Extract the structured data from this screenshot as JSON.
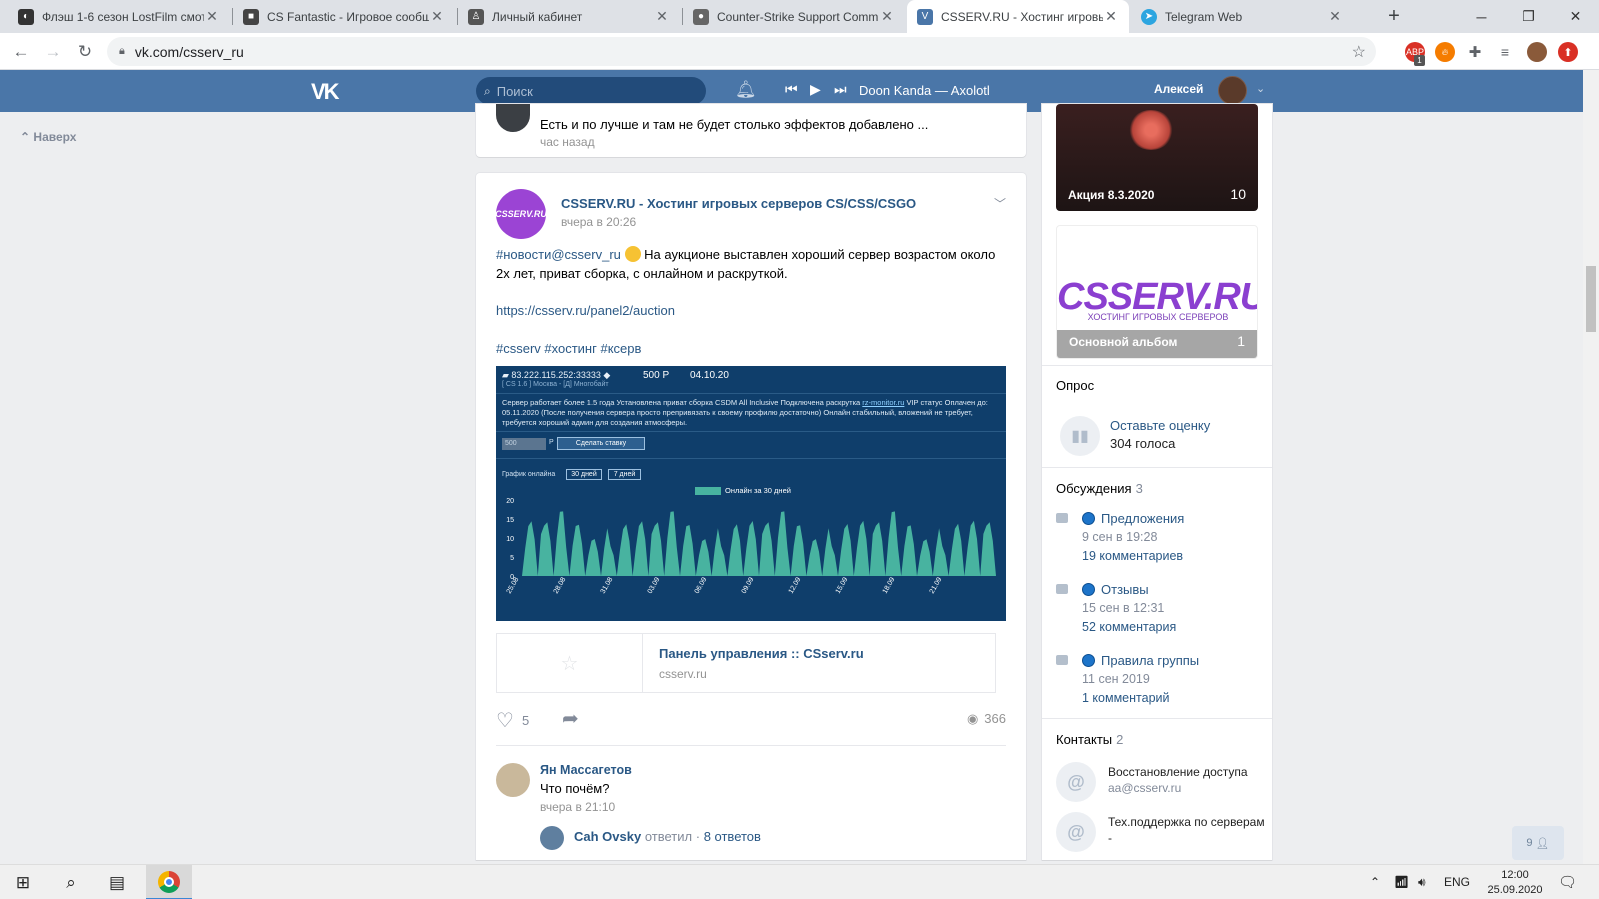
{
  "browser": {
    "tabs": [
      {
        "title": "Флэш 1-6 сезон LostFilm смот",
        "icon": "lostfilm-icon",
        "color": "#333333"
      },
      {
        "title": "CS Fantastic - Игровое сообщ",
        "icon": "csfantastic-icon",
        "color": "#444444"
      },
      {
        "title": "Личный кабинет",
        "icon": "cabinet-icon",
        "color": "#555555"
      },
      {
        "title": "Counter-Strike Support Comm",
        "icon": "cs-icon",
        "color": "#666666"
      },
      {
        "title": "CSSERV.RU - Хостинг игровых",
        "icon": "vk-icon",
        "color": "#4a76a8"
      },
      {
        "title": "Telegram Web",
        "icon": "telegram-icon",
        "color": "#2ca5e0"
      }
    ],
    "new_tab": "+",
    "url": "vk.com/csserv_ru",
    "ext_badge": "1"
  },
  "vk_header": {
    "logo": "VK",
    "search_placeholder": "Поиск",
    "now_playing": "Doon Kanda — Axolotl",
    "user_name": "Алексей"
  },
  "left": {
    "up_label": "Наверх"
  },
  "prev_post": {
    "comment_text": "Есть и по лучше и там не будет столько эффектов добавлено ...",
    "time": "час назад"
  },
  "post": {
    "author_avatar_text": "CSSERV.RU",
    "author": "CSSERV.RU - Хостинг игровых серверов CS/CSS/CSGO",
    "time": "вчера в 20:26",
    "hashtag": "#новости@csserv_ru",
    "text": "На аукционе выставлен хороший сервер возрастом около 2х лет, приват сборка, с онлайном и раскруткой.",
    "link": "https://csserv.ru/panel2/auction",
    "tags": "#csserv #хостинг #ксерв",
    "screenshot": {
      "ip": "83.222.115.252:33333",
      "meta": "[ CS 1.6 ] Москва - [Д] Многобайт",
      "price": "500 Р",
      "date": "04.10.20",
      "desc_before": "Сервер работает более 1.5 года Установлена приват сборка CSDM All Inclusive Подключена раскрутка ",
      "desc_link": "rz-monitor.ru",
      "desc_after": " VIP статус Оплачен до: 05.11.2020 (После получения сервера просто препривязать к своему профилю достаточно) Онлайн стабильный, вложений не требует, требуется хороший админ для создания атмосферы.",
      "bid_value": "500",
      "bid_currency": "Р",
      "bid_button": "Сделать ставку",
      "graph_label": "График онлайна",
      "btn_30": "30 дней",
      "btn_7": "7 дней",
      "legend": "Онлайн за 30 дней",
      "y_ticks": [
        "20",
        "15",
        "10",
        "5",
        "0"
      ],
      "x_ticks": [
        "25.08",
        "28.08",
        "31.08",
        "03.09",
        "06.09",
        "09.09",
        "12.09",
        "15.09",
        "18.09",
        "21.09"
      ]
    },
    "snippet_title": "Панель управления :: CSserv.ru",
    "snippet_domain": "csserv.ru",
    "likes": "5",
    "views": "366"
  },
  "comment": {
    "author": "Ян Массагетов",
    "text": "Что почём?",
    "time": "вчера в 21:10",
    "reply_author": "Cah Ovsky",
    "reply_verb": "ответил",
    "reply_sep": "·",
    "reply_count": "8 ответов"
  },
  "right": {
    "album1_label": "Акция 8.3.2020",
    "album1_count": "10",
    "album2_logo": "CSSERV.RU",
    "album2_sub": "ХОСТИНГ ИГРОВЫХ СЕРВЕРОВ",
    "album2_label": "Основной альбом",
    "album2_count": "1",
    "poll_header": "Опрос",
    "poll_title": "Оставьте оценку",
    "poll_votes": "304 голоса",
    "discussions_header": "Обсуждения",
    "discussions_count": "3",
    "discussions": [
      {
        "title": "Предложения",
        "date": "9 сен в 19:28",
        "comments": "19 комментариев"
      },
      {
        "title": "Отзывы",
        "date": "15 сен в 12:31",
        "comments": "52 комментария"
      },
      {
        "title": "Правила группы",
        "date": "11 сен 2019",
        "comments": "1 комментарий"
      }
    ],
    "contacts_header": "Контакты",
    "contacts_count": "2",
    "contacts": [
      {
        "name": "Восстановление доступа",
        "email": "aa@csserv.ru"
      },
      {
        "name": "Тех.поддержка по серверам -",
        "email": ""
      }
    ],
    "friends_online": "9"
  },
  "taskbar": {
    "lang": "ENG",
    "time": "12:00",
    "date": "25.09.2020"
  },
  "colors": {
    "vk_blue": "#4a76a8",
    "link": "#2a5885",
    "graph_bg": "#0f3e6b",
    "graph_bar": "#48b3a0"
  }
}
